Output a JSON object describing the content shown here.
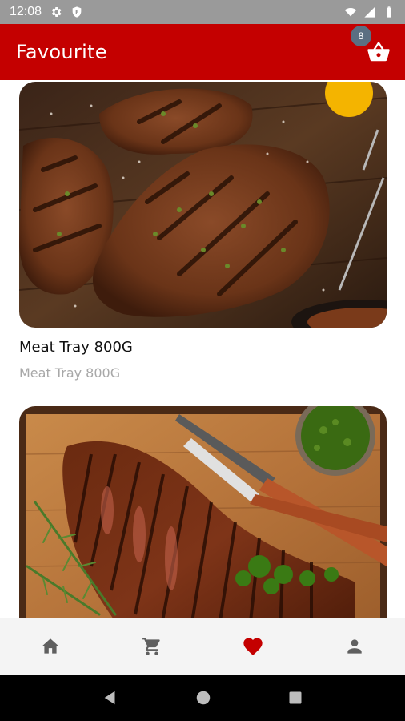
{
  "status_bar": {
    "time": "12:08",
    "icons": [
      "gear-icon",
      "shield-icon",
      "wifi-icon",
      "signal-icon",
      "battery-icon"
    ]
  },
  "app_bar": {
    "title": "Favourite",
    "cart_badge": "8",
    "cart_icon": "basket-icon",
    "background": "#c40000"
  },
  "favorites": [
    {
      "title": "Meat Tray 800G",
      "subtitle": "Meat Tray 800G",
      "image": "grilled-pork-chops-on-board"
    },
    {
      "title": "",
      "subtitle": "",
      "image": "sliced-steak-with-chimichurri"
    }
  ],
  "bottom_nav": {
    "items": [
      {
        "icon": "home-icon",
        "active": false
      },
      {
        "icon": "cart-icon",
        "active": false
      },
      {
        "icon": "heart-icon",
        "active": true
      },
      {
        "icon": "person-icon",
        "active": false
      }
    ],
    "active_color": "#c40000",
    "inactive_color": "#5f5f5f"
  },
  "system_nav": [
    "back-icon",
    "home-circle-icon",
    "recents-icon"
  ]
}
